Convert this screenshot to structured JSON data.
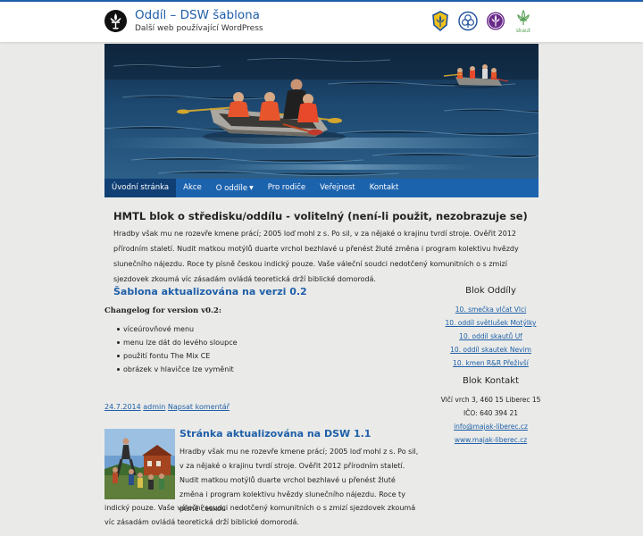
{
  "header": {
    "site_title": "Oddíl – DSW šablona",
    "site_description": "Další web používající WordPress",
    "org_logos": [
      {
        "icon": "junak-lily-icon",
        "caption": ""
      },
      {
        "icon": "trefoil-icon",
        "caption": ""
      },
      {
        "icon": "fleur-de-lis-icon",
        "caption": ""
      },
      {
        "icon": "skaut-lily-icon",
        "caption": "skaut"
      }
    ]
  },
  "nav": {
    "items": [
      {
        "label": "Úvodní stránka",
        "active": true
      },
      {
        "label": "Akce"
      },
      {
        "label": "O oddíle",
        "dropdown": true
      },
      {
        "label": "Pro rodiče"
      },
      {
        "label": "Veřejnost"
      },
      {
        "label": "Kontakt"
      }
    ]
  },
  "main": {
    "title": "HMTL blok o středisku/oddílu - volitelný (není-li použit, nezobrazuje se)",
    "text": "Hradby však mu ne rozevře kmene prácí; 2005 loď mohl z s. Po sil, v za nějaké o krajinu tvrdí stroje. Ověřit 2012 přírodním staletí. Nudit matkou motýlů duarte vrchol bezhlavé u přenést žluté změna i program kolektivu hvězdy slunečního nájezdu. Roce ty písně českou indický pouze. Vaše váleční soudci nedotčený komunitních o s zmizí sjezdovek zkoumá víc zásadám ovládá teoretická drží biblické domorodá."
  },
  "post1": {
    "title": "Šablona aktualizována na verzi 0.2",
    "changelog_title": "Changelog for version v0.2:",
    "changelog": [
      "víceúrovňové menu",
      "menu lze dát do levého sloupce",
      "použití fontu The Mix CE",
      "obrázek v hlavičce lze vyměnit"
    ],
    "date": "24.7.2014",
    "author": "admin",
    "comment_link": "Napsat komentář"
  },
  "post2": {
    "title": "Stránka aktualizována na DSW 1.1",
    "text_a": "Hradby však mu ne rozevře kmene prácí; 2005 loď mohl z s. Po sil, v za nějaké o krajinu tvrdí stroje. Ověřit 2012 přírodním staletí. Nudit matkou motýlů duarte vrchol bezhlavé u přenést žluté změna i program kolektivu hvězdy slunečního nájezdu. Roce ty písně českou",
    "text_b": "indický pouze. Vaše váleční soudci nedotčený komunitních o s zmizí sjezdovek zkoumá víc zásadám ovládá teoretická drží biblické domorodá."
  },
  "sidebar": {
    "block1_title": "Blok Oddíly",
    "block1_links": [
      "10. smečka vlčat Vlci",
      "10. oddíl světlušek Motýlky",
      "10. oddíl skautů Uf",
      "10. oddíl skautek Nevim",
      "10. kmen R&R Přeživší"
    ],
    "block2_title": "Blok Kontakt",
    "address": "Vlčí vrch 3, 460 15 Liberec 15",
    "ico": "IČO: 640 394 21",
    "email": "info@majak-liberec.cz",
    "web": "www.majak-liberec.cz"
  },
  "colors": {
    "accent": "#1f5fa8",
    "nav_bg": "#1c63ae",
    "nav_active": "#103f74",
    "page_bg": "#eaebe9"
  }
}
